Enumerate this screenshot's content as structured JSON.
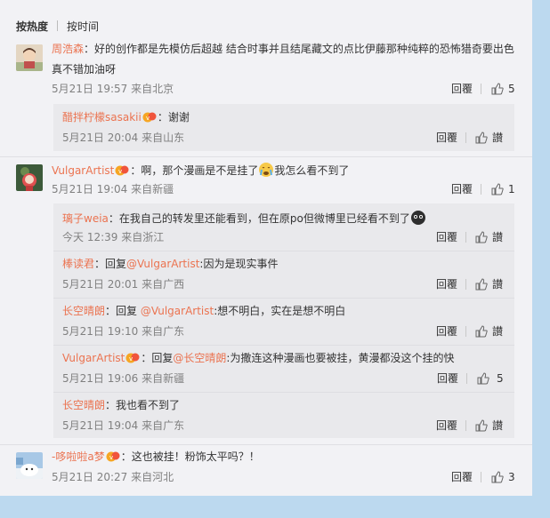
{
  "sort": {
    "hot": "按热度",
    "time": "按时间"
  },
  "comments": [
    {
      "user": "周浩森",
      "text1": "：好的创作都是先模仿后超越 结合时事并且结尾藏文的点比伊藤那种纯粹的恐怖猎奇要出色",
      "text2": "真不错加油呀",
      "meta": "5月21日 19:57 来自北京",
      "reply_label": "回覆",
      "likes": "5",
      "replies": [
        {
          "user": "醋拌柠檬sasakii",
          "text": "：谢谢",
          "meta": "5月21日 20:04 来自山东",
          "reply_label": "回覆",
          "like_label": "讃"
        }
      ]
    },
    {
      "user": "VulgarArtist",
      "text1": "：啊，那个漫画是不是挂了",
      "text1b": "我怎么看不到了",
      "meta": "5月21日 19:04 来自新疆",
      "reply_label": "回覆",
      "likes": "1",
      "replies": [
        {
          "user": "璃子weia",
          "text": "：在我自己的转发里还能看到，但在原po但微博里已经看不到了",
          "meta": "今天 12:39 来自浙江",
          "reply_label": "回覆",
          "like_label": "讃"
        },
        {
          "user": "棒读君",
          "pre": "：回复",
          "mention": "@VulgarArtist",
          "text": ":因为是现实事件",
          "meta": "5月21日 20:01 来自广西",
          "reply_label": "回覆",
          "like_label": "讃"
        },
        {
          "user": "长空晴朗",
          "pre": "：回复 ",
          "mention": "@VulgarArtist",
          "text": ":想不明白，实在是想不明白",
          "meta": "5月21日 19:10 来自广东",
          "reply_label": "回覆",
          "like_label": "讃"
        },
        {
          "user": "VulgarArtist",
          "pre": "：回复",
          "mention": "@长空晴朗",
          "text": ":为撒连这种漫画也要被挂，黄漫都没这个挂的快",
          "meta": "5月21日 19:06 来自新疆",
          "reply_label": "回覆",
          "likes": "5"
        },
        {
          "user": "长空晴朗",
          "text": "：我也看不到了",
          "meta": "5月21日 19:04 来自广东",
          "reply_label": "回覆",
          "like_label": "讃"
        }
      ]
    },
    {
      "user": "-哆啦啦a梦",
      "text1": "：这也被挂！粉饰太平吗？！",
      "meta": "5月21日 20:27 来自河北",
      "reply_label": "回覆",
      "likes": "3"
    }
  ],
  "icons": {
    "like": "thumbs-up-icon",
    "badge": "vip-badge-icon"
  },
  "colors": {
    "name": "#eb7350",
    "meta": "#808080",
    "background": "#f2f2f5",
    "reply_bg": "#e9e9ec"
  }
}
